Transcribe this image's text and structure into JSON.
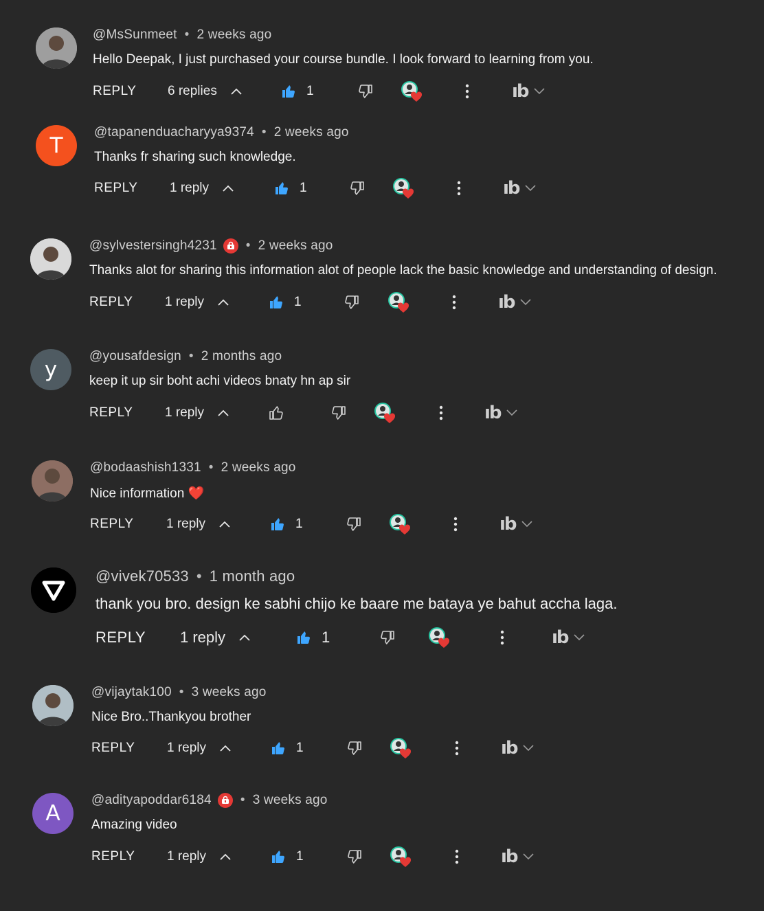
{
  "comments": [
    {
      "author": "@MsSunmeet",
      "time": "2 weeks ago",
      "text": "Hello Deepak, I just purchased your course bundle. I look forward to learning from you.",
      "reply_label": "REPLY",
      "replies": "6 replies",
      "likes": "1",
      "liked": true,
      "badge": false,
      "avatar_type": "photo",
      "avatar_letter": "",
      "avatar_color": "#9e9e9e"
    },
    {
      "author": "@tapanenduacharyya9374",
      "time": "2 weeks ago",
      "text": "Thanks fr sharing such knowledge.",
      "reply_label": "REPLY",
      "replies": "1 reply",
      "likes": "1",
      "liked": true,
      "badge": false,
      "avatar_type": "letter",
      "avatar_letter": "T",
      "avatar_color": "#f4511e"
    },
    {
      "author": "@sylvestersingh4231",
      "time": "2 weeks ago",
      "text": "Thanks alot for sharing this information alot of people lack the basic knowledge and understanding of design.",
      "reply_label": "REPLY",
      "replies": "1 reply",
      "likes": "1",
      "liked": true,
      "badge": true,
      "avatar_type": "photo",
      "avatar_letter": "",
      "avatar_color": "#d9d9d9"
    },
    {
      "author": "@yousafdesign",
      "time": "2 months ago",
      "text": "keep it up sir boht achi videos bnaty hn ap sir",
      "reply_label": "REPLY",
      "replies": "1 reply",
      "likes": "",
      "liked": false,
      "badge": false,
      "avatar_type": "letter",
      "avatar_letter": "y",
      "avatar_color": "#4f5b62"
    },
    {
      "author": "@bodaashish1331",
      "time": "2 weeks ago",
      "text": "Nice information",
      "emoji": "❤️",
      "reply_label": "REPLY",
      "replies": "1 reply",
      "likes": "1",
      "liked": true,
      "badge": false,
      "avatar_type": "photo",
      "avatar_letter": "",
      "avatar_color": "#8d6e63"
    },
    {
      "author": "@vivek70533",
      "time": "1 month ago",
      "text": "thank you bro. design ke sabhi chijo ke baare me bataya ye bahut accha laga.",
      "reply_label": "REPLY",
      "replies": "1 reply",
      "likes": "1",
      "liked": true,
      "badge": false,
      "avatar_type": "logo",
      "avatar_letter": "",
      "avatar_color": "#000000"
    },
    {
      "author": "@vijaytak100",
      "time": "3 weeks ago",
      "text": "Nice Bro..Thankyou brother",
      "reply_label": "REPLY",
      "replies": "1 reply",
      "likes": "1",
      "liked": true,
      "badge": false,
      "avatar_type": "photo",
      "avatar_letter": "",
      "avatar_color": "#b0bec5"
    },
    {
      "author": "@adityapoddar6184",
      "time": "3 weeks ago",
      "text": "Amazing video",
      "reply_label": "REPLY",
      "replies": "1 reply",
      "likes": "1",
      "liked": true,
      "badge": true,
      "avatar_type": "letter",
      "avatar_letter": "A",
      "avatar_color": "#7e57c2"
    }
  ],
  "colors": {
    "background": "#282828",
    "like_active": "#3ea6ff",
    "heart": "#e53935",
    "creator_teal": "#26c6a2"
  },
  "icons": {
    "like": "thumb-up-icon",
    "dislike": "thumb-down-icon",
    "heart": "creator-heart-icon",
    "more": "more-vert-icon",
    "chevron": "chevron-up-icon",
    "extension": "ib-extension-icon",
    "badge": "member-badge-icon"
  }
}
